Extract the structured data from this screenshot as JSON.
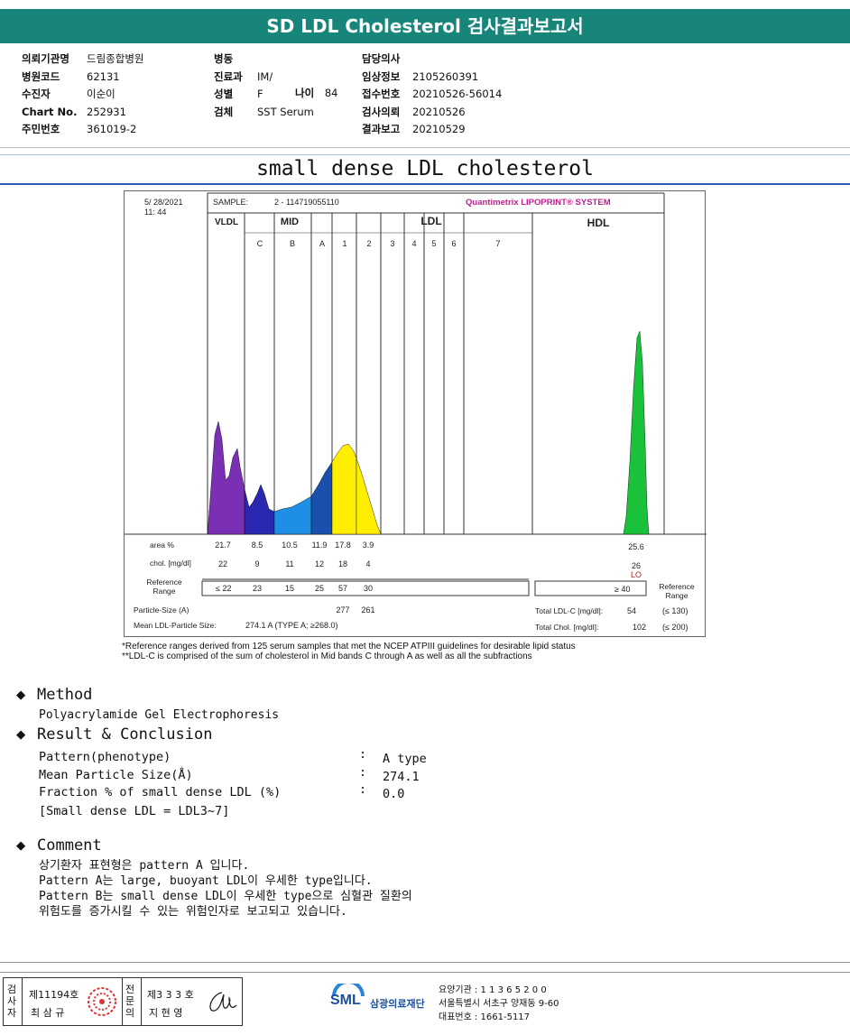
{
  "report": {
    "title": "SD LDL Cholesterol 검사결과보고서",
    "col1": [
      {
        "label": "의뢰기관명",
        "value": "드림종합병원"
      },
      {
        "label": "병원코드",
        "value": "62131"
      },
      {
        "label": "수진자",
        "value": "이순이"
      },
      {
        "label": "Chart No.",
        "value": "252931"
      },
      {
        "label": "주민번호",
        "value": "361019-2"
      }
    ],
    "col2": [
      {
        "label": "병동",
        "value": ""
      },
      {
        "label": "진료과",
        "value": "IM/"
      },
      {
        "label": "성별",
        "value": "F"
      },
      {
        "label": "검체",
        "value": "SST Serum"
      }
    ],
    "age_label": "나이",
    "age_value": "84",
    "col3": [
      {
        "label": "담당의사",
        "value": ""
      },
      {
        "label": "임상정보",
        "value": "2105260391"
      },
      {
        "label": "접수번호",
        "value": "20210526-56014"
      },
      {
        "label": "검사의뢰",
        "value": "20210526"
      },
      {
        "label": "결과보고",
        "value": "20210529"
      }
    ]
  },
  "main_title": "small dense LDL cholesterol",
  "chart_header": {
    "date": "5/ 28/2021",
    "time": "11: 44",
    "sample_label": "SAMPLE:",
    "sample_value": "2 - 114719055110",
    "brand": "Quantimetrix LIPOPRINT® SYSTEM"
  },
  "chart_data": {
    "type": "area",
    "title": "small dense LDL cholesterol",
    "groups": [
      "VLDL",
      "MID",
      "LDL",
      "HDL"
    ],
    "bands": [
      "C",
      "B",
      "A",
      "1",
      "2",
      "3",
      "4",
      "5",
      "6",
      "7"
    ],
    "series": [
      {
        "name": "VLDL",
        "color": "#7b2fb5",
        "area_pct": 21.7,
        "chol": 22
      },
      {
        "name": "MID C",
        "color": "#2a27b0",
        "area_pct": 8.5,
        "chol": 9
      },
      {
        "name": "MID B",
        "color": "#1f8fe6",
        "area_pct": 10.5,
        "chol": 11
      },
      {
        "name": "MID A",
        "color": "#1a4fae",
        "area_pct": 11.9,
        "chol": 12
      },
      {
        "name": "LDL 1",
        "color": "#ffee00",
        "area_pct": 17.8,
        "chol": 18
      },
      {
        "name": "LDL 2",
        "color": "#ffee00",
        "area_pct": 3.9,
        "chol": 4
      },
      {
        "name": "HDL",
        "color": "#19c23a",
        "area_pct": 25.6,
        "chol": 26
      }
    ],
    "rows": {
      "area_label": "area %",
      "area_values": [
        "21.7",
        "8.5",
        "10.5",
        "11.9",
        "17.8",
        "3.9"
      ],
      "hdl_area": "25.6",
      "chol_label": "chol. [mg/dl]",
      "chol_values": [
        "22",
        "9",
        "11",
        "12",
        "18",
        "4"
      ],
      "hdl_chol": "26",
      "hdl_flag": "LO",
      "ref_label": "Reference Range",
      "ref_values": [
        "≤ 22",
        "23",
        "15",
        "25",
        "57",
        "30"
      ],
      "hdl_ref": "≥  40",
      "ref_right_label": "Reference Range",
      "particle_label": "Particle-Size  (A)",
      "particle_values": [
        "277",
        "261"
      ],
      "mean_label": "Mean LDL-Particle Size:",
      "mean_value": "274.1 A   (TYPE A; ≥268.0)",
      "total_ldl_label": "Total LDL-C  [mg/dl]:",
      "total_ldl_value": "54",
      "total_ldl_ref": "(≤ 130)",
      "total_chol_label": "Total Chol.  [mg/dl]:",
      "total_chol_value": "102",
      "total_chol_ref": "(≤ 200)"
    }
  },
  "footnotes": [
    "*Reference ranges derived from 125 serum samples that met the NCEP ATPIII guidelines for desirable lipid status",
    "**LDL-C is comprised of the sum of cholesterol in Mid bands C through A as well as all the subfractions"
  ],
  "method": {
    "heading": "Method",
    "text": "Polyacrylamide Gel Electrophoresis"
  },
  "result": {
    "heading": "Result & Conclusion",
    "items": [
      {
        "label": "Pattern(phenotype)",
        "value": "A type"
      },
      {
        "label": "Mean Particle Size(Å)",
        "value": "274.1"
      },
      {
        "label": "Fraction % of small dense LDL (%)",
        "value": "0.0"
      }
    ],
    "note": "[Small dense LDL = LDL3~7]"
  },
  "comment": {
    "heading": "Comment",
    "lines": [
      "상기환자 표현형은 pattern A 입니다.",
      "Pattern A는 large, buoyant LDL이 우세한 type입니다.",
      "Pattern B는 small dense LDL이 우세한 type으로 심혈관 질환의",
      "위험도를 증가시킬 수 있는 위험인자로 보고되고 있습니다."
    ]
  },
  "signature": {
    "tester_label": "검사자",
    "tester_no": "제11194호",
    "tester_name": "최 삼 규",
    "expert_label": "전문의",
    "expert_no": "제3 3 3 호",
    "expert_name": "지 현 영"
  },
  "lab": {
    "logo": "SML",
    "name": "삼광의료재단",
    "line1": "요양기관 : 1 1 3 6 5 2 0 0",
    "line2": "서울특별시 서초구 양재동 9-60",
    "line3": "대표번호 : 1661-5117"
  },
  "colors": {
    "banner": "#17857a",
    "title_line": "#2a5db0",
    "brand": "#c0208f"
  }
}
